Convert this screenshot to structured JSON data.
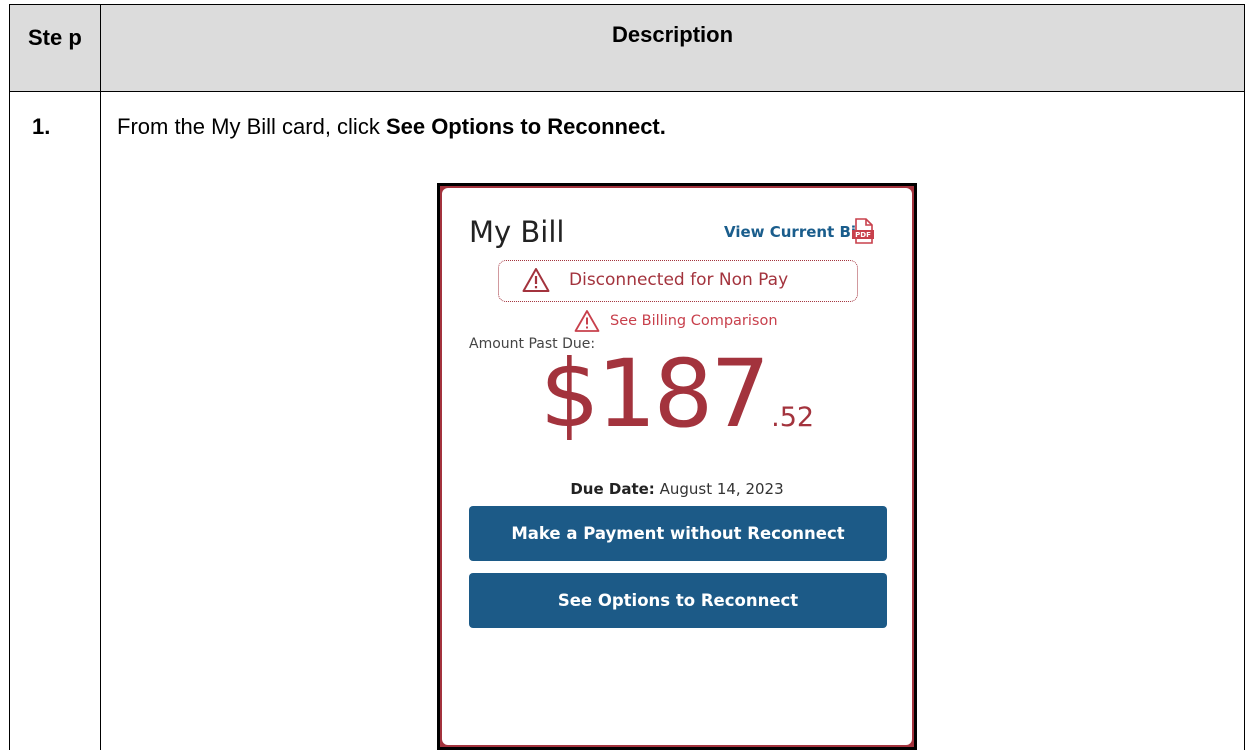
{
  "table": {
    "header": {
      "step": "Ste p",
      "description": "Description"
    },
    "rows": [
      {
        "step": "1.",
        "instruction_prefix": "From the My Bill card, click ",
        "instruction_bold": "See Options to Reconnect."
      }
    ]
  },
  "bill_card": {
    "title": "My Bill",
    "view_bill_link": "View Current Bill",
    "pdf_icon_label": "PDF",
    "status_alert": "Disconnected for Non Pay",
    "comparison_link": "See Billing Comparison",
    "amount_label": "Amount Past Due:",
    "amount_dollars": "$187",
    "amount_cents": ".52",
    "due_date_label": "Due Date:",
    "due_date_value": "August 14, 2023",
    "buttons": {
      "make_payment": "Make a Payment without Reconnect",
      "see_options": "See Options to Reconnect"
    },
    "colors": {
      "alert_red": "#a3333d",
      "link_blue": "#1a5d8c",
      "button_blue": "#1c5a87",
      "header_gray": "#dcdcdc"
    },
    "icons": {
      "pdf": "pdf-icon",
      "warning": "warning-triangle-icon"
    }
  }
}
